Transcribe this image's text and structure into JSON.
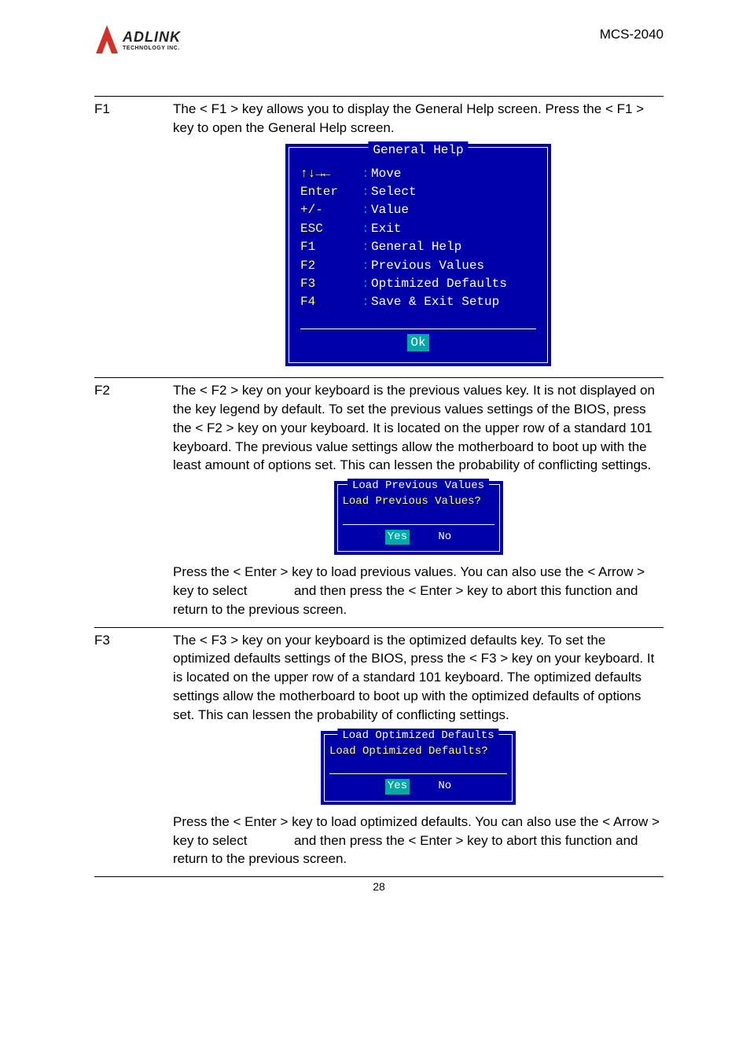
{
  "header": {
    "logo_text": "ADLINK",
    "logo_sub": "TECHNOLOGY INC.",
    "doc_title": "MCS-2040"
  },
  "f1": {
    "key": "F1",
    "desc": "The < F1 > key allows you to display the General Help screen. Press the < F1 > key to open the General Help screen.",
    "bios": {
      "title": "General Help",
      "rows": [
        {
          "k": "↑↓→←",
          "v": "Move"
        },
        {
          "k": "Enter",
          "v": "Select"
        },
        {
          "k": "+/-",
          "v": "Value"
        },
        {
          "k": "ESC",
          "v": "Exit"
        },
        {
          "k": "F1",
          "v": "General Help"
        },
        {
          "k": "F2",
          "v": "Previous Values"
        },
        {
          "k": "F3",
          "v": "Optimized Defaults"
        },
        {
          "k": "F4",
          "v": "Save & Exit Setup"
        }
      ],
      "ok": "Ok"
    }
  },
  "f2": {
    "key": "F2",
    "desc1": "The < F2 > key on your keyboard is the previous values key. It is not displayed on the key legend by default. To set the previous values settings of the BIOS, press the < F2 > key on your keyboard. It is located on the upper row of a standard 101 keyboard. The previous value settings allow the motherboard to boot up with the least amount of options set. This can lessen the probability of conflicting settings.",
    "bios": {
      "title": "Load Previous Values",
      "question": "Load Previous Values?",
      "yes": "Yes",
      "no": "No"
    },
    "desc2a": "Press the < Enter > key to load previous values. You can also use the < Arrow > key to select ",
    "desc2b": " and then press the < Enter > key to abort this function and return to the previous screen."
  },
  "f3": {
    "key": "F3",
    "desc1": "The < F3 > key on your keyboard is the optimized defaults key. To set the optimized defaults settings of the BIOS, press the < F3 > key on your keyboard. It is located on the upper row of a standard 101 keyboard. The optimized defaults settings allow the motherboard to boot up with the optimized defaults of options set. This can lessen the probability of conflicting settings.",
    "bios": {
      "title": "Load Optimized Defaults",
      "question": "Load Optimized Defaults?",
      "yes": "Yes",
      "no": "No"
    },
    "desc2a": "Press the < Enter > key to load optimized defaults. You can also use the < Arrow > key to select ",
    "desc2b": " and then press the < Enter > key to abort this function and return to the previous screen."
  },
  "page_number": "28"
}
